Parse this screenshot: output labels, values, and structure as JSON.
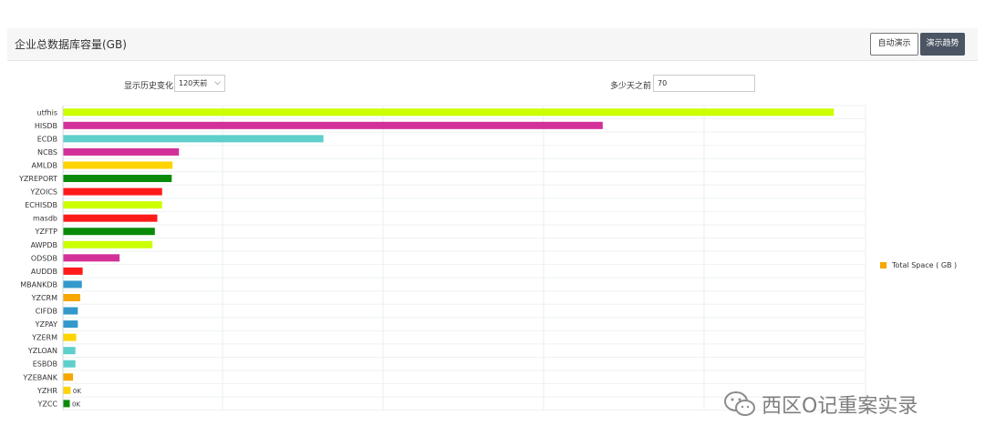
{
  "header": {
    "title": "企业总数据库容量(GB)",
    "auto_demo_label": "自动演示",
    "trend_demo_label": "演示趋势"
  },
  "filters": {
    "history_label": "显示历史变化",
    "history_value": "120天前",
    "days_label": "多少天之前",
    "days_value": "70"
  },
  "legend": {
    "label": "Total Space ( GB )",
    "color": "#f7a700"
  },
  "watermark": {
    "text": "西区O记重案实录",
    "icon": "wechat-icon"
  },
  "chart_data": {
    "type": "bar",
    "orientation": "horizontal",
    "categories": [
      "utfhis",
      "HISDB",
      "ECDB",
      "NCBS",
      "AMLDB",
      "YZREPORT",
      "YZOICS",
      "ECHISDB",
      "masdb",
      "YZFTP",
      "AWPDB",
      "ODSDB",
      "AUDDB",
      "MBANKDB",
      "YZCRM",
      "CIFDB",
      "YZPAY",
      "YZERM",
      "YZLOAN",
      "ESBDB",
      "YZEBANK",
      "YZHR",
      "YZCC"
    ],
    "series": [
      {
        "name": "Total Space ( GB )",
        "values": [
          960,
          672,
          324,
          144,
          136,
          135,
          123,
          123,
          117,
          114,
          111,
          70,
          24,
          23,
          21,
          18,
          18,
          16,
          15,
          15,
          12,
          9,
          8
        ],
        "colors": [
          "#ccff00",
          "#d3309a",
          "#5ecfcb",
          "#d3309a",
          "#ffd400",
          "#0a8a0a",
          "#ff1a1a",
          "#ccff00",
          "#ff1a1a",
          "#0a8a0a",
          "#ccff00",
          "#d3309a",
          "#ff1a1a",
          "#3399cc",
          "#f7a700",
          "#3399cc",
          "#3399cc",
          "#ffd400",
          "#5ecfcb",
          "#5ecfcb",
          "#f7a700",
          "#ffd400",
          "#0a8a0a"
        ]
      }
    ],
    "data_labels": {
      "YZHR": "0K",
      "YZCC": "0K"
    },
    "grid": true,
    "xlim": [
      0,
      1000
    ],
    "legend_position": "right"
  }
}
